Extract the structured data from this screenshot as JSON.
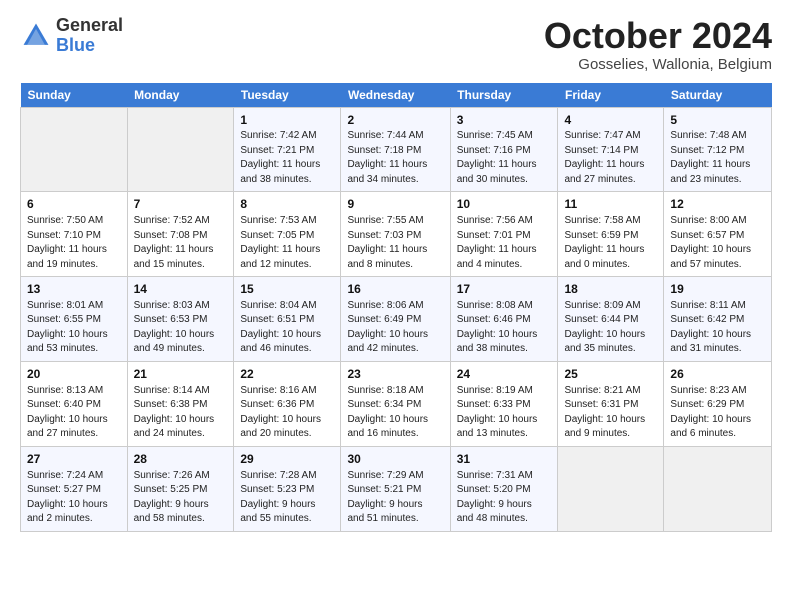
{
  "header": {
    "logo_general": "General",
    "logo_blue": "Blue",
    "month_title": "October 2024",
    "location": "Gosselies, Wallonia, Belgium"
  },
  "days_of_week": [
    "Sunday",
    "Monday",
    "Tuesday",
    "Wednesday",
    "Thursday",
    "Friday",
    "Saturday"
  ],
  "weeks": [
    [
      {
        "day": "",
        "info": ""
      },
      {
        "day": "",
        "info": ""
      },
      {
        "day": "1",
        "info": "Sunrise: 7:42 AM\nSunset: 7:21 PM\nDaylight: 11 hours\nand 38 minutes."
      },
      {
        "day": "2",
        "info": "Sunrise: 7:44 AM\nSunset: 7:18 PM\nDaylight: 11 hours\nand 34 minutes."
      },
      {
        "day": "3",
        "info": "Sunrise: 7:45 AM\nSunset: 7:16 PM\nDaylight: 11 hours\nand 30 minutes."
      },
      {
        "day": "4",
        "info": "Sunrise: 7:47 AM\nSunset: 7:14 PM\nDaylight: 11 hours\nand 27 minutes."
      },
      {
        "day": "5",
        "info": "Sunrise: 7:48 AM\nSunset: 7:12 PM\nDaylight: 11 hours\nand 23 minutes."
      }
    ],
    [
      {
        "day": "6",
        "info": "Sunrise: 7:50 AM\nSunset: 7:10 PM\nDaylight: 11 hours\nand 19 minutes."
      },
      {
        "day": "7",
        "info": "Sunrise: 7:52 AM\nSunset: 7:08 PM\nDaylight: 11 hours\nand 15 minutes."
      },
      {
        "day": "8",
        "info": "Sunrise: 7:53 AM\nSunset: 7:05 PM\nDaylight: 11 hours\nand 12 minutes."
      },
      {
        "day": "9",
        "info": "Sunrise: 7:55 AM\nSunset: 7:03 PM\nDaylight: 11 hours\nand 8 minutes."
      },
      {
        "day": "10",
        "info": "Sunrise: 7:56 AM\nSunset: 7:01 PM\nDaylight: 11 hours\nand 4 minutes."
      },
      {
        "day": "11",
        "info": "Sunrise: 7:58 AM\nSunset: 6:59 PM\nDaylight: 11 hours\nand 0 minutes."
      },
      {
        "day": "12",
        "info": "Sunrise: 8:00 AM\nSunset: 6:57 PM\nDaylight: 10 hours\nand 57 minutes."
      }
    ],
    [
      {
        "day": "13",
        "info": "Sunrise: 8:01 AM\nSunset: 6:55 PM\nDaylight: 10 hours\nand 53 minutes."
      },
      {
        "day": "14",
        "info": "Sunrise: 8:03 AM\nSunset: 6:53 PM\nDaylight: 10 hours\nand 49 minutes."
      },
      {
        "day": "15",
        "info": "Sunrise: 8:04 AM\nSunset: 6:51 PM\nDaylight: 10 hours\nand 46 minutes."
      },
      {
        "day": "16",
        "info": "Sunrise: 8:06 AM\nSunset: 6:49 PM\nDaylight: 10 hours\nand 42 minutes."
      },
      {
        "day": "17",
        "info": "Sunrise: 8:08 AM\nSunset: 6:46 PM\nDaylight: 10 hours\nand 38 minutes."
      },
      {
        "day": "18",
        "info": "Sunrise: 8:09 AM\nSunset: 6:44 PM\nDaylight: 10 hours\nand 35 minutes."
      },
      {
        "day": "19",
        "info": "Sunrise: 8:11 AM\nSunset: 6:42 PM\nDaylight: 10 hours\nand 31 minutes."
      }
    ],
    [
      {
        "day": "20",
        "info": "Sunrise: 8:13 AM\nSunset: 6:40 PM\nDaylight: 10 hours\nand 27 minutes."
      },
      {
        "day": "21",
        "info": "Sunrise: 8:14 AM\nSunset: 6:38 PM\nDaylight: 10 hours\nand 24 minutes."
      },
      {
        "day": "22",
        "info": "Sunrise: 8:16 AM\nSunset: 6:36 PM\nDaylight: 10 hours\nand 20 minutes."
      },
      {
        "day": "23",
        "info": "Sunrise: 8:18 AM\nSunset: 6:34 PM\nDaylight: 10 hours\nand 16 minutes."
      },
      {
        "day": "24",
        "info": "Sunrise: 8:19 AM\nSunset: 6:33 PM\nDaylight: 10 hours\nand 13 minutes."
      },
      {
        "day": "25",
        "info": "Sunrise: 8:21 AM\nSunset: 6:31 PM\nDaylight: 10 hours\nand 9 minutes."
      },
      {
        "day": "26",
        "info": "Sunrise: 8:23 AM\nSunset: 6:29 PM\nDaylight: 10 hours\nand 6 minutes."
      }
    ],
    [
      {
        "day": "27",
        "info": "Sunrise: 7:24 AM\nSunset: 5:27 PM\nDaylight: 10 hours\nand 2 minutes."
      },
      {
        "day": "28",
        "info": "Sunrise: 7:26 AM\nSunset: 5:25 PM\nDaylight: 9 hours\nand 58 minutes."
      },
      {
        "day": "29",
        "info": "Sunrise: 7:28 AM\nSunset: 5:23 PM\nDaylight: 9 hours\nand 55 minutes."
      },
      {
        "day": "30",
        "info": "Sunrise: 7:29 AM\nSunset: 5:21 PM\nDaylight: 9 hours\nand 51 minutes."
      },
      {
        "day": "31",
        "info": "Sunrise: 7:31 AM\nSunset: 5:20 PM\nDaylight: 9 hours\nand 48 minutes."
      },
      {
        "day": "",
        "info": ""
      },
      {
        "day": "",
        "info": ""
      }
    ]
  ]
}
